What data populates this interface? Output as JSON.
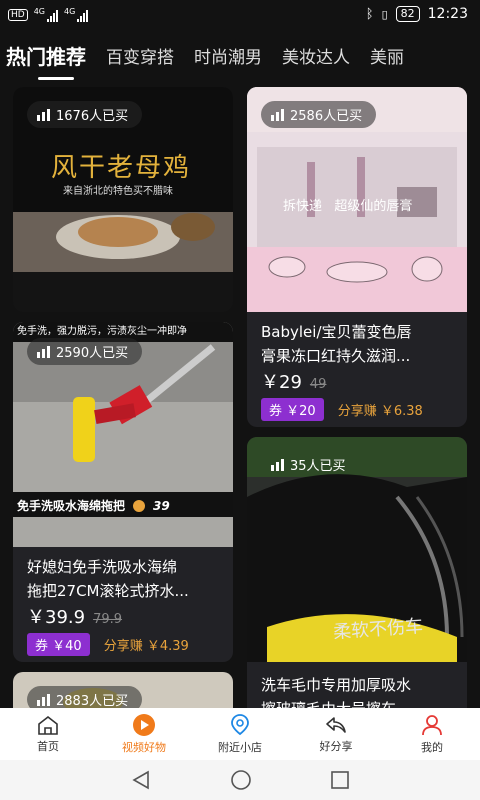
{
  "status": {
    "network": "HD",
    "signal1": "4G",
    "signal2": "4G",
    "battery": "82",
    "time": "12:23"
  },
  "tabs": [
    "热门推荐",
    "百变穿搭",
    "时尚潮男",
    "美妆达人",
    "美丽"
  ],
  "cards": [
    {
      "sold": "1676人已买",
      "image_text": "风干老母鸡",
      "image_subtext": "来自浙北的特色买不腊味"
    },
    {
      "sold": "2586人已买",
      "image_text": "拆快递   超级仙的唇膏",
      "title_line1": "Babylei/宝贝蕾变色唇",
      "title_line2": "膏果冻口红持久滋润...",
      "price": "￥29",
      "old_price": "49",
      "coupon": "券 ￥20",
      "share": "分享赚 ￥6.38"
    },
    {
      "sold": "2590人已买",
      "image_top": "免手洗，强力脱污，污渍灰尘一冲即净",
      "image_caption": "免手洗吸水海绵拖把",
      "image_price": "39",
      "title_line1": "好媳妇免手洗吸水海绵",
      "title_line2": "拖把27CM滚轮式挤水...",
      "price": "￥39.9",
      "old_price": "79.9",
      "coupon": "券 ￥40",
      "share": "分享赚 ￥4.39"
    },
    {
      "sold": "35人已买",
      "image_text": "柔软不伤车",
      "title_line1": "洗车毛巾专用加厚吸水",
      "title_line2": "擦玻璃毛巾大号擦车..."
    },
    {
      "sold": "2883人已买"
    }
  ],
  "nav": [
    {
      "label": "首页",
      "icon": "home-icon"
    },
    {
      "label": "视频好物",
      "icon": "video-play-icon"
    },
    {
      "label": "附近小店",
      "icon": "location-icon"
    },
    {
      "label": "好分享",
      "icon": "share-icon"
    },
    {
      "label": "我的",
      "icon": "user-icon"
    }
  ],
  "colors": {
    "accent": "#f07a1a",
    "coupon": "#8d2fd0",
    "share": "#e8a33c",
    "background": "#121212"
  }
}
